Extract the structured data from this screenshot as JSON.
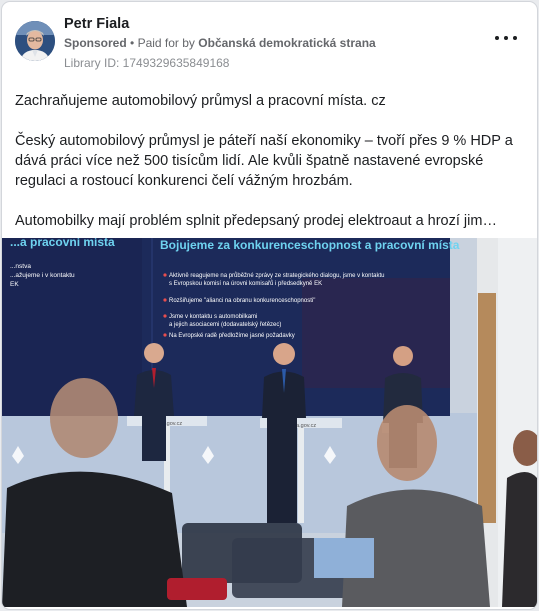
{
  "post": {
    "author": "Petr Fiala",
    "sponsored_label": "Sponsored",
    "dot": "•",
    "paid_for_label": "Paid for by",
    "advertiser": "Občanská demokratická strana",
    "library_id": "Library ID: 1749329635849168",
    "more_icon": "more-horizontal-icon",
    "body": [
      "Zachraňujeme automobilový průmysl a pracovní místa. cz",
      "Český automobilový průmysl je páteří naší ekonomiky – tvoří přes 9 % HDP a dává práci více než 500 tisícům lidí. Ale kvůli špatně nastavené evropské regulaci a rostoucí konkurenci čelí vážným hrozbám.",
      "Automobilky mají problém splnit předepsaný prodej elektroaut a hrozí jim…"
    ]
  },
  "photo": {
    "screen_left_title": "...a pracovní místa",
    "screen_left_lines": [
      "...nstva",
      "...ažujeme i v kontaktu",
      "EK"
    ],
    "screen_title": "Bojujeme za konkurenceschopnost a pracovní místa",
    "screen_bullets": [
      "Aktivně reagujeme na průběžné zprávy ze strategického dialogu, jsme v kontaktu",
      "s Evropskou komisí na úrovni komisařů i předsedkyně EK",
      "Rozšiřujeme \"alianci na obranu konkurenceschopnosti\"",
      "Jsme v kontaktu s automobilkami",
      "a jejich asociacemi (dodavatelský řetězec)",
      "Na Evropské radě předložíme jasné požadavky"
    ],
    "podium_sign": "vlada.gov.cz"
  },
  "colors": {
    "text_primary": "#1c1e21",
    "text_secondary": "#65676b",
    "screen_bg": "#1c2a5a",
    "screen_title": "#6fd3f0"
  }
}
